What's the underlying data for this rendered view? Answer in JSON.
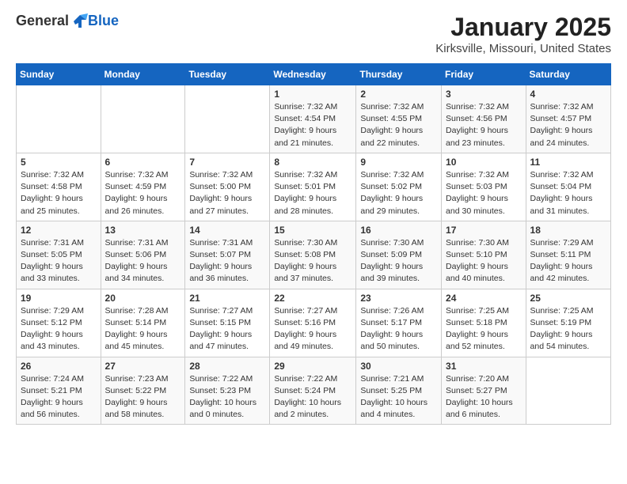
{
  "header": {
    "logo_general": "General",
    "logo_blue": "Blue",
    "month": "January 2025",
    "location": "Kirksville, Missouri, United States"
  },
  "days_of_week": [
    "Sunday",
    "Monday",
    "Tuesday",
    "Wednesday",
    "Thursday",
    "Friday",
    "Saturday"
  ],
  "weeks": [
    [
      {
        "day": "",
        "content": ""
      },
      {
        "day": "",
        "content": ""
      },
      {
        "day": "",
        "content": ""
      },
      {
        "day": "1",
        "content": "Sunrise: 7:32 AM\nSunset: 4:54 PM\nDaylight: 9 hours and 21 minutes."
      },
      {
        "day": "2",
        "content": "Sunrise: 7:32 AM\nSunset: 4:55 PM\nDaylight: 9 hours and 22 minutes."
      },
      {
        "day": "3",
        "content": "Sunrise: 7:32 AM\nSunset: 4:56 PM\nDaylight: 9 hours and 23 minutes."
      },
      {
        "day": "4",
        "content": "Sunrise: 7:32 AM\nSunset: 4:57 PM\nDaylight: 9 hours and 24 minutes."
      }
    ],
    [
      {
        "day": "5",
        "content": "Sunrise: 7:32 AM\nSunset: 4:58 PM\nDaylight: 9 hours and 25 minutes."
      },
      {
        "day": "6",
        "content": "Sunrise: 7:32 AM\nSunset: 4:59 PM\nDaylight: 9 hours and 26 minutes."
      },
      {
        "day": "7",
        "content": "Sunrise: 7:32 AM\nSunset: 5:00 PM\nDaylight: 9 hours and 27 minutes."
      },
      {
        "day": "8",
        "content": "Sunrise: 7:32 AM\nSunset: 5:01 PM\nDaylight: 9 hours and 28 minutes."
      },
      {
        "day": "9",
        "content": "Sunrise: 7:32 AM\nSunset: 5:02 PM\nDaylight: 9 hours and 29 minutes."
      },
      {
        "day": "10",
        "content": "Sunrise: 7:32 AM\nSunset: 5:03 PM\nDaylight: 9 hours and 30 minutes."
      },
      {
        "day": "11",
        "content": "Sunrise: 7:32 AM\nSunset: 5:04 PM\nDaylight: 9 hours and 31 minutes."
      }
    ],
    [
      {
        "day": "12",
        "content": "Sunrise: 7:31 AM\nSunset: 5:05 PM\nDaylight: 9 hours and 33 minutes."
      },
      {
        "day": "13",
        "content": "Sunrise: 7:31 AM\nSunset: 5:06 PM\nDaylight: 9 hours and 34 minutes."
      },
      {
        "day": "14",
        "content": "Sunrise: 7:31 AM\nSunset: 5:07 PM\nDaylight: 9 hours and 36 minutes."
      },
      {
        "day": "15",
        "content": "Sunrise: 7:30 AM\nSunset: 5:08 PM\nDaylight: 9 hours and 37 minutes."
      },
      {
        "day": "16",
        "content": "Sunrise: 7:30 AM\nSunset: 5:09 PM\nDaylight: 9 hours and 39 minutes."
      },
      {
        "day": "17",
        "content": "Sunrise: 7:30 AM\nSunset: 5:10 PM\nDaylight: 9 hours and 40 minutes."
      },
      {
        "day": "18",
        "content": "Sunrise: 7:29 AM\nSunset: 5:11 PM\nDaylight: 9 hours and 42 minutes."
      }
    ],
    [
      {
        "day": "19",
        "content": "Sunrise: 7:29 AM\nSunset: 5:12 PM\nDaylight: 9 hours and 43 minutes."
      },
      {
        "day": "20",
        "content": "Sunrise: 7:28 AM\nSunset: 5:14 PM\nDaylight: 9 hours and 45 minutes."
      },
      {
        "day": "21",
        "content": "Sunrise: 7:27 AM\nSunset: 5:15 PM\nDaylight: 9 hours and 47 minutes."
      },
      {
        "day": "22",
        "content": "Sunrise: 7:27 AM\nSunset: 5:16 PM\nDaylight: 9 hours and 49 minutes."
      },
      {
        "day": "23",
        "content": "Sunrise: 7:26 AM\nSunset: 5:17 PM\nDaylight: 9 hours and 50 minutes."
      },
      {
        "day": "24",
        "content": "Sunrise: 7:25 AM\nSunset: 5:18 PM\nDaylight: 9 hours and 52 minutes."
      },
      {
        "day": "25",
        "content": "Sunrise: 7:25 AM\nSunset: 5:19 PM\nDaylight: 9 hours and 54 minutes."
      }
    ],
    [
      {
        "day": "26",
        "content": "Sunrise: 7:24 AM\nSunset: 5:21 PM\nDaylight: 9 hours and 56 minutes."
      },
      {
        "day": "27",
        "content": "Sunrise: 7:23 AM\nSunset: 5:22 PM\nDaylight: 9 hours and 58 minutes."
      },
      {
        "day": "28",
        "content": "Sunrise: 7:22 AM\nSunset: 5:23 PM\nDaylight: 10 hours and 0 minutes."
      },
      {
        "day": "29",
        "content": "Sunrise: 7:22 AM\nSunset: 5:24 PM\nDaylight: 10 hours and 2 minutes."
      },
      {
        "day": "30",
        "content": "Sunrise: 7:21 AM\nSunset: 5:25 PM\nDaylight: 10 hours and 4 minutes."
      },
      {
        "day": "31",
        "content": "Sunrise: 7:20 AM\nSunset: 5:27 PM\nDaylight: 10 hours and 6 minutes."
      },
      {
        "day": "",
        "content": ""
      }
    ]
  ]
}
